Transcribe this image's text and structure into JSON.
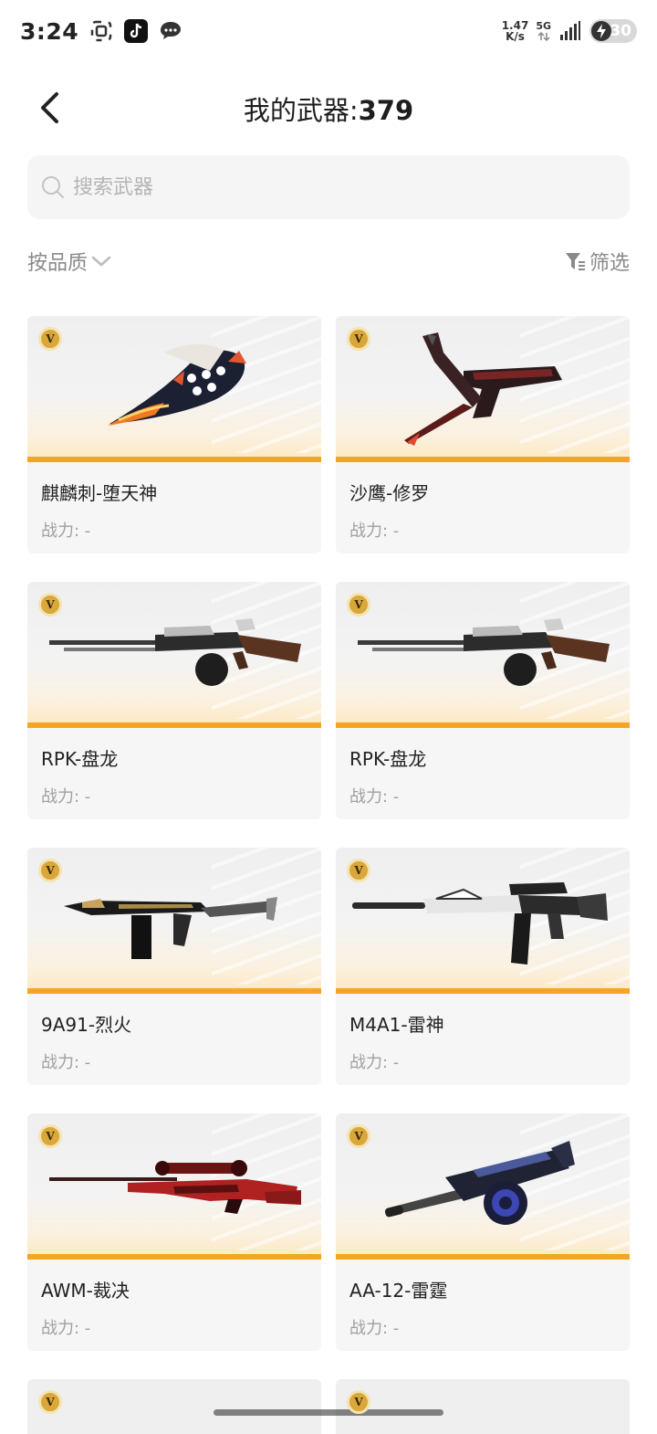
{
  "status_bar": {
    "time": "3:24",
    "speed_value": "1.47",
    "speed_unit": "K/s",
    "network": "5G",
    "battery": "30"
  },
  "header": {
    "title_prefix": "我的武器:",
    "title_count": "379"
  },
  "search": {
    "placeholder": "搜索武器"
  },
  "filters": {
    "sort_label": "按品质",
    "filter_label": "筛选"
  },
  "badge_text": "V",
  "power_label": "战力: -",
  "weapons": [
    {
      "name": "麒麟刺-堕天神"
    },
    {
      "name": "沙鹰-修罗"
    },
    {
      "name": "RPK-盘龙"
    },
    {
      "name": "RPK-盘龙"
    },
    {
      "name": "9A91-烈火"
    },
    {
      "name": "M4A1-雷神"
    },
    {
      "name": "AWM-裁决"
    },
    {
      "name": "AA-12-雷霆"
    }
  ],
  "colors": {
    "accent_orange": "#f4a623",
    "badge_gold": "#d9a73a",
    "card_bg": "#f6f6f6",
    "muted_text": "#a0a0a0"
  },
  "icons": {
    "back": "chevron-left-icon",
    "search": "search-icon",
    "sort": "chevron-down-icon",
    "filter": "funnel-icon"
  }
}
